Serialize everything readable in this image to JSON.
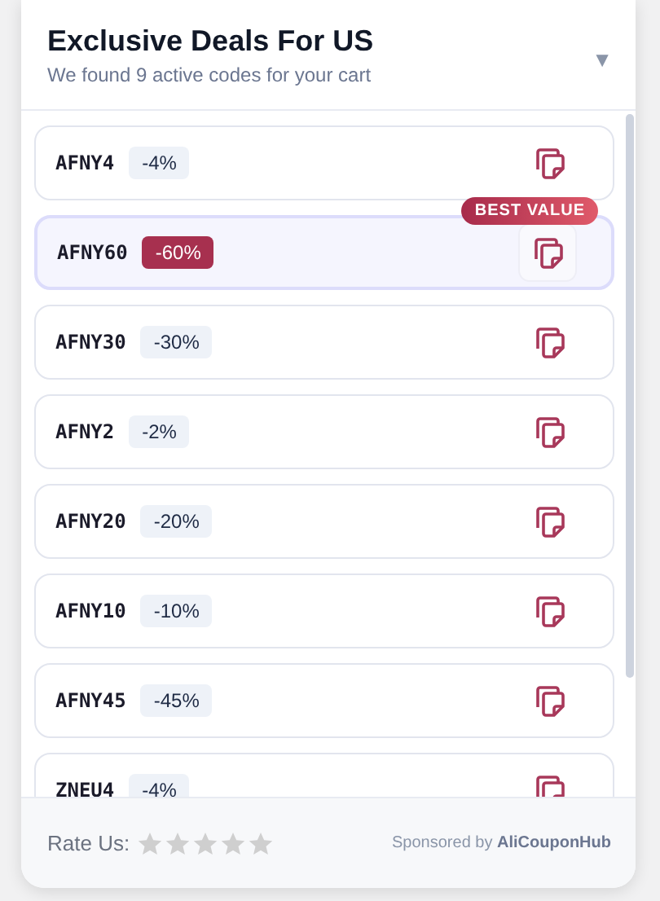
{
  "header": {
    "title": "Exclusive Deals For US",
    "subtitle": "We found 9 active codes for your cart",
    "collapse_icon": "▼"
  },
  "coupons": [
    {
      "code": "AFNY4",
      "discount": "-4%",
      "selected": false
    },
    {
      "code": "AFNY60",
      "discount": "-60%",
      "selected": true,
      "tag": "BEST VALUE"
    },
    {
      "code": "AFNY30",
      "discount": "-30%",
      "selected": false
    },
    {
      "code": "AFNY2",
      "discount": "-2%",
      "selected": false
    },
    {
      "code": "AFNY20",
      "discount": "-20%",
      "selected": false
    },
    {
      "code": "AFNY10",
      "discount": "-10%",
      "selected": false
    },
    {
      "code": "AFNY45",
      "discount": "-45%",
      "selected": false
    },
    {
      "code": "ZNEU4",
      "discount": "-4%",
      "selected": false
    }
  ],
  "footer": {
    "rate_label": "Rate Us:",
    "stars": 0,
    "sponsor_prefix": "Sponsored by",
    "sponsor_name": "AliCouponHub"
  }
}
